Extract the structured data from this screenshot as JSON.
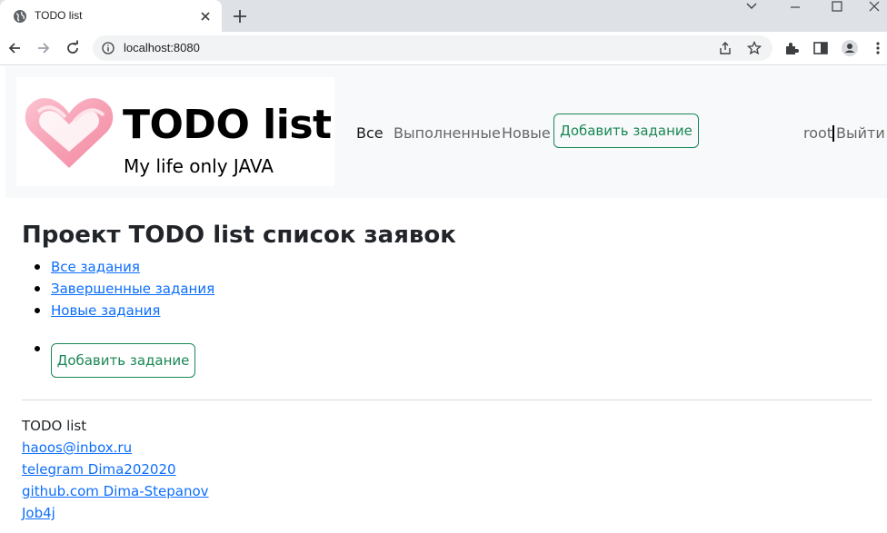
{
  "browser": {
    "tab_title": "TODO list",
    "url": "localhost:8080"
  },
  "navbar": {
    "logo_title": "TODO list",
    "logo_subtitle": "My life only JAVA",
    "links": [
      {
        "label": "Все"
      },
      {
        "label": "Выполненные"
      },
      {
        "label": "Новые"
      }
    ],
    "add_button": "Добавить задание",
    "user": "root",
    "logout": "Выйти"
  },
  "main": {
    "heading": "Проект TODO list список заявок",
    "links": [
      {
        "label": "Все задания"
      },
      {
        "label": "Завершенные задания"
      },
      {
        "label": "Новые задания"
      }
    ],
    "add_button": "Добавить задание"
  },
  "footer": {
    "title": "TODO list",
    "links": [
      {
        "label": "haoos@inbox.ru"
      },
      {
        "label": "telegram Dima202020"
      },
      {
        "label": "github.com Dima-Stepanov"
      },
      {
        "label": "Job4j"
      }
    ]
  },
  "colors": {
    "success": "#198754",
    "link": "#0d6efd",
    "navbar_bg": "#f8f9fa",
    "heart_pink": "#f7a1b5"
  },
  "icons": [
    "globe-icon",
    "close-icon",
    "plus-icon",
    "chevron-down-icon",
    "minimize-icon",
    "maximize-icon",
    "back-icon",
    "forward-icon",
    "reload-icon",
    "info-icon",
    "share-icon",
    "star-icon",
    "extensions-icon",
    "sidebar-icon",
    "profile-icon",
    "menu-icon",
    "heart-logo-icon"
  ]
}
